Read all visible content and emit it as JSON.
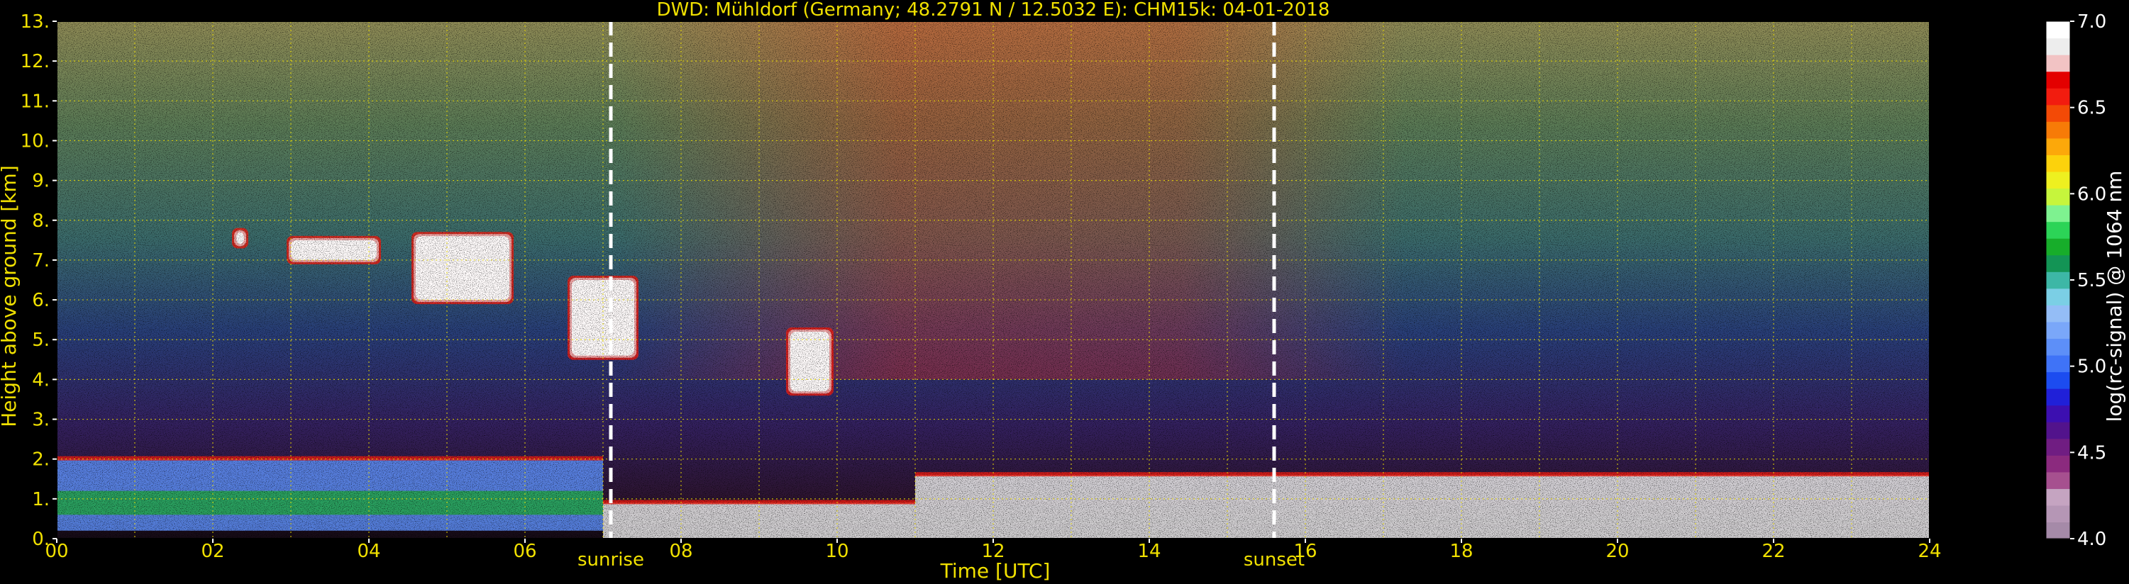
{
  "chart_data": {
    "type": "heatmap",
    "title": "DWD: Mühldorf (Germany; 48.2791 N / 12.5032 E):    CHM15k: 04-01-2018",
    "xlabel": "Time [UTC]",
    "ylabel": "Height above ground [km]",
    "xlim": [
      0,
      24
    ],
    "ylim": [
      0,
      13
    ],
    "x_ticks": [
      "00",
      "02",
      "04",
      "06",
      "08",
      "10",
      "12",
      "14",
      "16",
      "18",
      "20",
      "22",
      "24"
    ],
    "y_ticks": [
      "0.",
      "1.",
      "2.",
      "3.",
      "4.",
      "5.",
      "6.",
      "7.",
      "8.",
      "9.",
      "10.",
      "11.",
      "12.",
      "13."
    ],
    "grid": true,
    "markers": [
      {
        "label": "sunrise",
        "x": 7.1
      },
      {
        "label": "sunset",
        "x": 15.6
      }
    ],
    "colorbar": {
      "label": "log(rc-signal) @ 1064 nm",
      "range": [
        4.0,
        7.0
      ],
      "ticks": [
        "4.0",
        "4.5",
        "5.0",
        "5.5",
        "6.0",
        "6.5",
        "7.0"
      ],
      "colors": [
        "#a58aa8",
        "#b596b5",
        "#c5a4c1",
        "#a6508f",
        "#8b2a7e",
        "#701d82",
        "#52138c",
        "#3c0fb0",
        "#2020d8",
        "#1c4cf0",
        "#3f73f7",
        "#5d8ff8",
        "#7aa7f9",
        "#94bdf6",
        "#7bcfe5",
        "#3db7a6",
        "#139455",
        "#17ad2a",
        "#2cd457",
        "#7ef290",
        "#c6f53c",
        "#eef020",
        "#fcd20c",
        "#fca80a",
        "#f77b07",
        "#f34a06",
        "#f21c0f",
        "#e30000",
        "#f2c3c4",
        "#ededed",
        "#ffffff"
      ]
    },
    "features": [
      {
        "type": "cloud",
        "time": [
          2.3,
          2.4
        ],
        "height": [
          7.4,
          7.7
        ]
      },
      {
        "type": "cloud",
        "time": [
          3.0,
          4.1
        ],
        "height": [
          7.0,
          7.5
        ]
      },
      {
        "type": "cloud",
        "time": [
          4.6,
          5.8
        ],
        "height": [
          6.0,
          7.6
        ]
      },
      {
        "type": "cloud",
        "time": [
          6.6,
          7.4
        ],
        "height": [
          4.6,
          6.5
        ]
      },
      {
        "type": "cloud",
        "time": [
          9.4,
          9.9
        ],
        "height": [
          3.7,
          5.2
        ]
      },
      {
        "type": "boundary_layer",
        "time": [
          0,
          7.0
        ],
        "height": [
          0.2,
          2.0
        ]
      },
      {
        "type": "boundary_layer",
        "time": [
          7.0,
          11.0
        ],
        "height": [
          0,
          0.9
        ]
      },
      {
        "type": "boundary_layer",
        "time": [
          11.0,
          24.0
        ],
        "height": [
          0,
          1.6
        ]
      }
    ]
  }
}
